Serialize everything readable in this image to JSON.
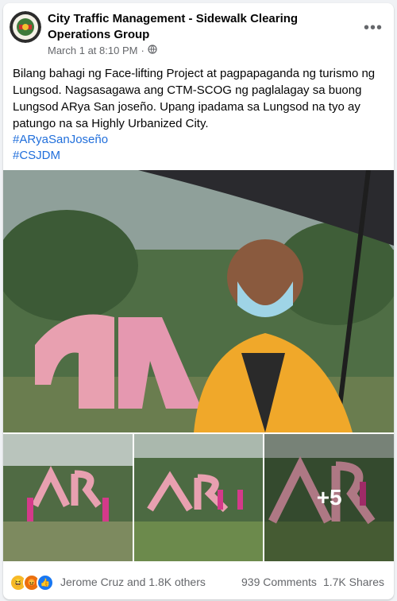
{
  "group": {
    "name": "City Traffic Management - Sidewalk Clearing Operations Group",
    "timestamp": "March 1 at 8:10 PM",
    "visibility_icon": "globe-icon"
  },
  "post": {
    "text": "Bilang bahagi ng Face-lifting Project at pagpapaganda ng turismo ng Lungsod. Nagsasagawa ang CTM-SCOG ng paglalagay sa buong Lungsod ARya San joseño. Upang ipadama sa Lungsod na tyo ay patungo na sa Highly Urbanized City.",
    "hashtags": [
      "#ARyaSanJoseño",
      "#CSJDM"
    ]
  },
  "photos": {
    "more_count": "+5"
  },
  "engagement": {
    "reacted_by": "Jerome Cruz and 1.8K others",
    "comments": "939 Comments",
    "shares": "1.7K Shares",
    "reaction_icons": [
      "haha-icon",
      "angry-icon",
      "like-icon"
    ]
  },
  "colors": {
    "link": "#216fdb",
    "muted": "#65676b",
    "like": "#1877f2"
  }
}
